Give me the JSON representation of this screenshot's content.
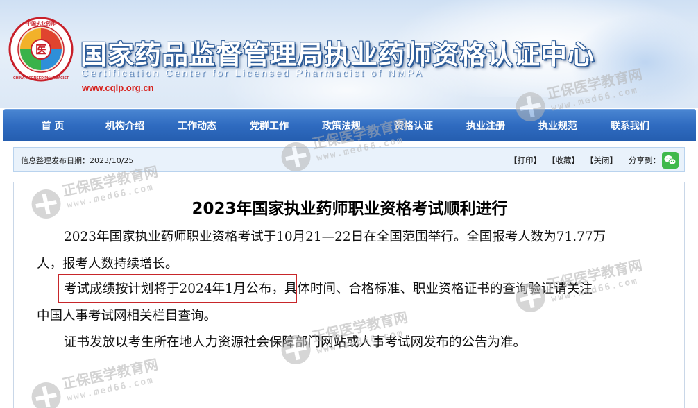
{
  "header": {
    "title": "国家药品监督管理局执业药师资格认证中心",
    "subtitle": "Certification Center for Licensed Pharmacist of NMPA",
    "url": "www.cqlp.org.cn",
    "logo_text_top": "中国执业药师",
    "logo_text_bottom": "CHINA LICENSED PHARMACIST",
    "logo_center": "医"
  },
  "nav": {
    "items": [
      {
        "label": "首 页"
      },
      {
        "label": "机构介绍"
      },
      {
        "label": "工作动态"
      },
      {
        "label": "党群工作"
      },
      {
        "label": "政策法规"
      },
      {
        "label": "资格认证"
      },
      {
        "label": "执业注册"
      },
      {
        "label": "执业规范"
      },
      {
        "label": "联系我们"
      }
    ]
  },
  "infobar": {
    "publish_date": "信息整理发布日期：2023/10/25",
    "print": "【打印】",
    "favorite": "【收藏】",
    "close": "【关闭】",
    "share_label": "分享到：",
    "wechat_icon": "wechat-icon"
  },
  "article": {
    "title": "2023年国家执业药师职业资格考试顺利进行",
    "lines": [
      "2023年国家执业药师职业资格考试于10月21—22日在全国范围举行。全国报考人数为71.77万",
      "人，报考人数持续增长。",
      "考试成绩按计划将于2024年1月公布，具体时间、合格标准、职业资格证书的查询验证请关注",
      "中国人事考试网相关栏目查询。",
      "证书发放以考生所在地人力资源社会保障部门网站或人事考试网发布的公告为准。"
    ]
  },
  "watermark": {
    "name": "正保医学教育网",
    "url": "www.med66.com"
  },
  "colors": {
    "nav_blue": "#2f6bc0",
    "url_red": "#d6201b",
    "highlight_red": "#c7262a",
    "wechat_green": "#3fb94c"
  }
}
